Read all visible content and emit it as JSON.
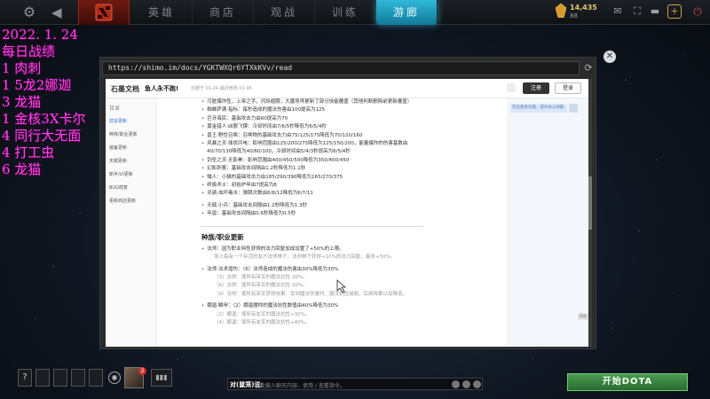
{
  "topbar": {
    "nav": [
      {
        "label": "英雄",
        "active": false
      },
      {
        "label": "商店",
        "active": false
      },
      {
        "label": "观战",
        "active": false
      },
      {
        "label": "训练",
        "active": false
      },
      {
        "label": "游廊",
        "active": true
      }
    ],
    "currency": "14,435",
    "currency_sub": "88",
    "accent": "#2fb8d8"
  },
  "overlay": {
    "color": "#ff44ee",
    "lines": [
      "2022. 1. 24",
      "每日战绩",
      "1  肉刺",
      "1  5龙2娜迦",
      "3  龙猫",
      "1  金核3X卡尔",
      "4  同行大无面",
      "4  打工虫",
      "6  龙猫"
    ]
  },
  "browser": {
    "url": "https://shimo.im/docs/YGKTWXQr6YTXkKVv/read",
    "header": {
      "brand": "石墨文档",
      "title": "鱼人永不跑!",
      "meta": "创建于 01-24  最近修改 01:46",
      "login": "注册",
      "register": "登录"
    },
    "sidebar": {
      "head": "目录",
      "items": [
        "前言更新",
        "种族/职业更新",
        "装备更新",
        "天赋更新",
        "新手/UI更新",
        "BUG修复",
        "更新商店更新"
      ],
      "active_index": 0
    },
    "tip": "开启更多功能，提升办公效能",
    "help": "帮助",
    "lines": [
      {
        "text": "污脏爆炸性，上帝之手，闪烁翅膀，大魔导师更新了部分技能覆盖（其他判断删除前更新覆盖）",
        "kind": "bullet"
      },
      {
        "text": "蜘蛛萨满·指标：每秒造成的魔法伤害由100提高为125",
        "kind": "bullet"
      },
      {
        "text": "巨牙海民：基础攻击力由60提高为70",
        "kind": "bullet"
      },
      {
        "text": "黄金猎人·凶狠飞镖：冷却时间由7/6/5秒降低为6/5/4秒",
        "kind": "bullet"
      },
      {
        "text": "兽王·野性召唤：召唤物的基础攻击力由75/125/175降低为70/120/160",
        "kind": "bullet"
      },
      {
        "text": "风暴之灵·球状闪电：影响范围由125/200/275降低为125/150/200，能量爆炸的伤害基数由",
        "kind": "bullet"
      },
      {
        "text": "40/70/130降低为40/60/100，冷却时间由5/4/3秒提高为6/5/4秒",
        "kind": "cont"
      },
      {
        "text": "剑圣之灵·无影拳：影响范围由400/450/500降低为350/400/450",
        "kind": "bullet"
      },
      {
        "text": "幻影刺客：基础攻击间隔由1.2秒降低为1.1秒",
        "kind": "bullet"
      },
      {
        "text": "矮人：小猫的基础攻击力由185/290/390降低为165/270/375",
        "kind": "bullet"
      },
      {
        "text": "终极术士：初始护甲由7提高为8",
        "kind": "bullet"
      },
      {
        "text": "灵骑·血坏毒水：弹跳次数由6/8/12降低为6/7/11",
        "kind": "bullet"
      },
      {
        "text": "天赋·小兵：基础攻击间隔由1.2秒降低为1.3秒",
        "kind": "bullet gap"
      },
      {
        "text": "年兽：基础攻击间隔由0.6秒降低为0.5秒",
        "kind": "bullet"
      },
      {
        "text": "种族/职业更新",
        "kind": "section"
      },
      {
        "text": "法师：因为职业特性获得的法力回复加成设置了+50%的上限。",
        "kind": "bullet"
      },
      {
        "text": "场上每有一个存活的友方法师棋子，法师棋子获得+10%的法力回复，最多+50%。",
        "kind": "sub"
      },
      {
        "text": "法师·法术增伤：（6）法师造成的魔法伤害由30%降低为30%",
        "kind": "bullet gap"
      },
      {
        "text": "（3）法师：使所有英军的魔法抗性-30%。",
        "kind": "sub"
      },
      {
        "text": "（6）法师：使所有英军的魔法抗性-30%。",
        "kind": "sub"
      },
      {
        "text": "（9）法师：使所有英军获得效果：受到魔法伤害时，魔法抗性减弱，后续效果以及降低。",
        "kind": "sub"
      },
      {
        "text": "娜迦·鳞甲：（2）娜迦摆你的魔法抗性数值由40%降低为30%",
        "kind": "bullet gap"
      },
      {
        "text": "（2）娜迦：使所有友军的魔法抗性+30%。",
        "kind": "sub"
      },
      {
        "text": "（4）娜迦：使所有友军的魔法抗性+40%。",
        "kind": "sub"
      }
    ]
  },
  "bottombar": {
    "help": "?",
    "friend_badge": "2",
    "chat_prefix": "对(鼠笼)说:",
    "chat_placeholder": "在此输入聊天内容，使用 / 查看指令。",
    "play": "开始DOTA"
  }
}
